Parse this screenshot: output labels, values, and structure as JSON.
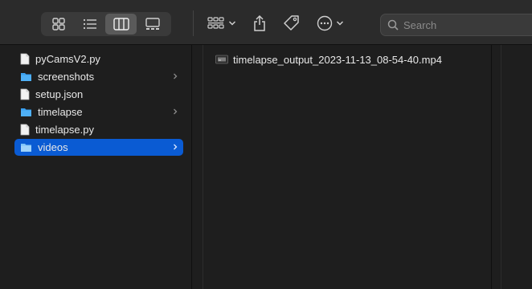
{
  "toolbar": {
    "view_buttons": [
      {
        "name": "icon-view",
        "icon": "grid-icon",
        "active": false
      },
      {
        "name": "list-view",
        "icon": "list-icon",
        "active": false
      },
      {
        "name": "column-view",
        "icon": "columns-icon",
        "active": true
      },
      {
        "name": "gallery-view",
        "icon": "gallery-icon",
        "active": false
      }
    ],
    "group_icon": "group-grid-icon",
    "share_icon": "share-icon",
    "tag_icon": "tag-icon",
    "more_icon": "ellipsis-circle-icon",
    "search": {
      "placeholder": "Search",
      "value": ""
    }
  },
  "column1": {
    "items": [
      {
        "label": "pyCamsV2.py",
        "type": "file",
        "selected": false
      },
      {
        "label": "screenshots",
        "type": "folder",
        "selected": false
      },
      {
        "label": "setup.json",
        "type": "file",
        "selected": false
      },
      {
        "label": "timelapse",
        "type": "folder",
        "selected": false
      },
      {
        "label": "timelapse.py",
        "type": "file",
        "selected": false
      },
      {
        "label": "videos",
        "type": "folder",
        "selected": true
      }
    ]
  },
  "column2": {
    "items": [
      {
        "label": "timelapse_output_2023-11-13_08-54-40.mp4",
        "type": "video"
      }
    ]
  },
  "colors": {
    "selection": "#0a5bd3",
    "folder": "#3aa0f0",
    "background": "#1e1e1e",
    "toolbar": "#2b2b2b"
  }
}
